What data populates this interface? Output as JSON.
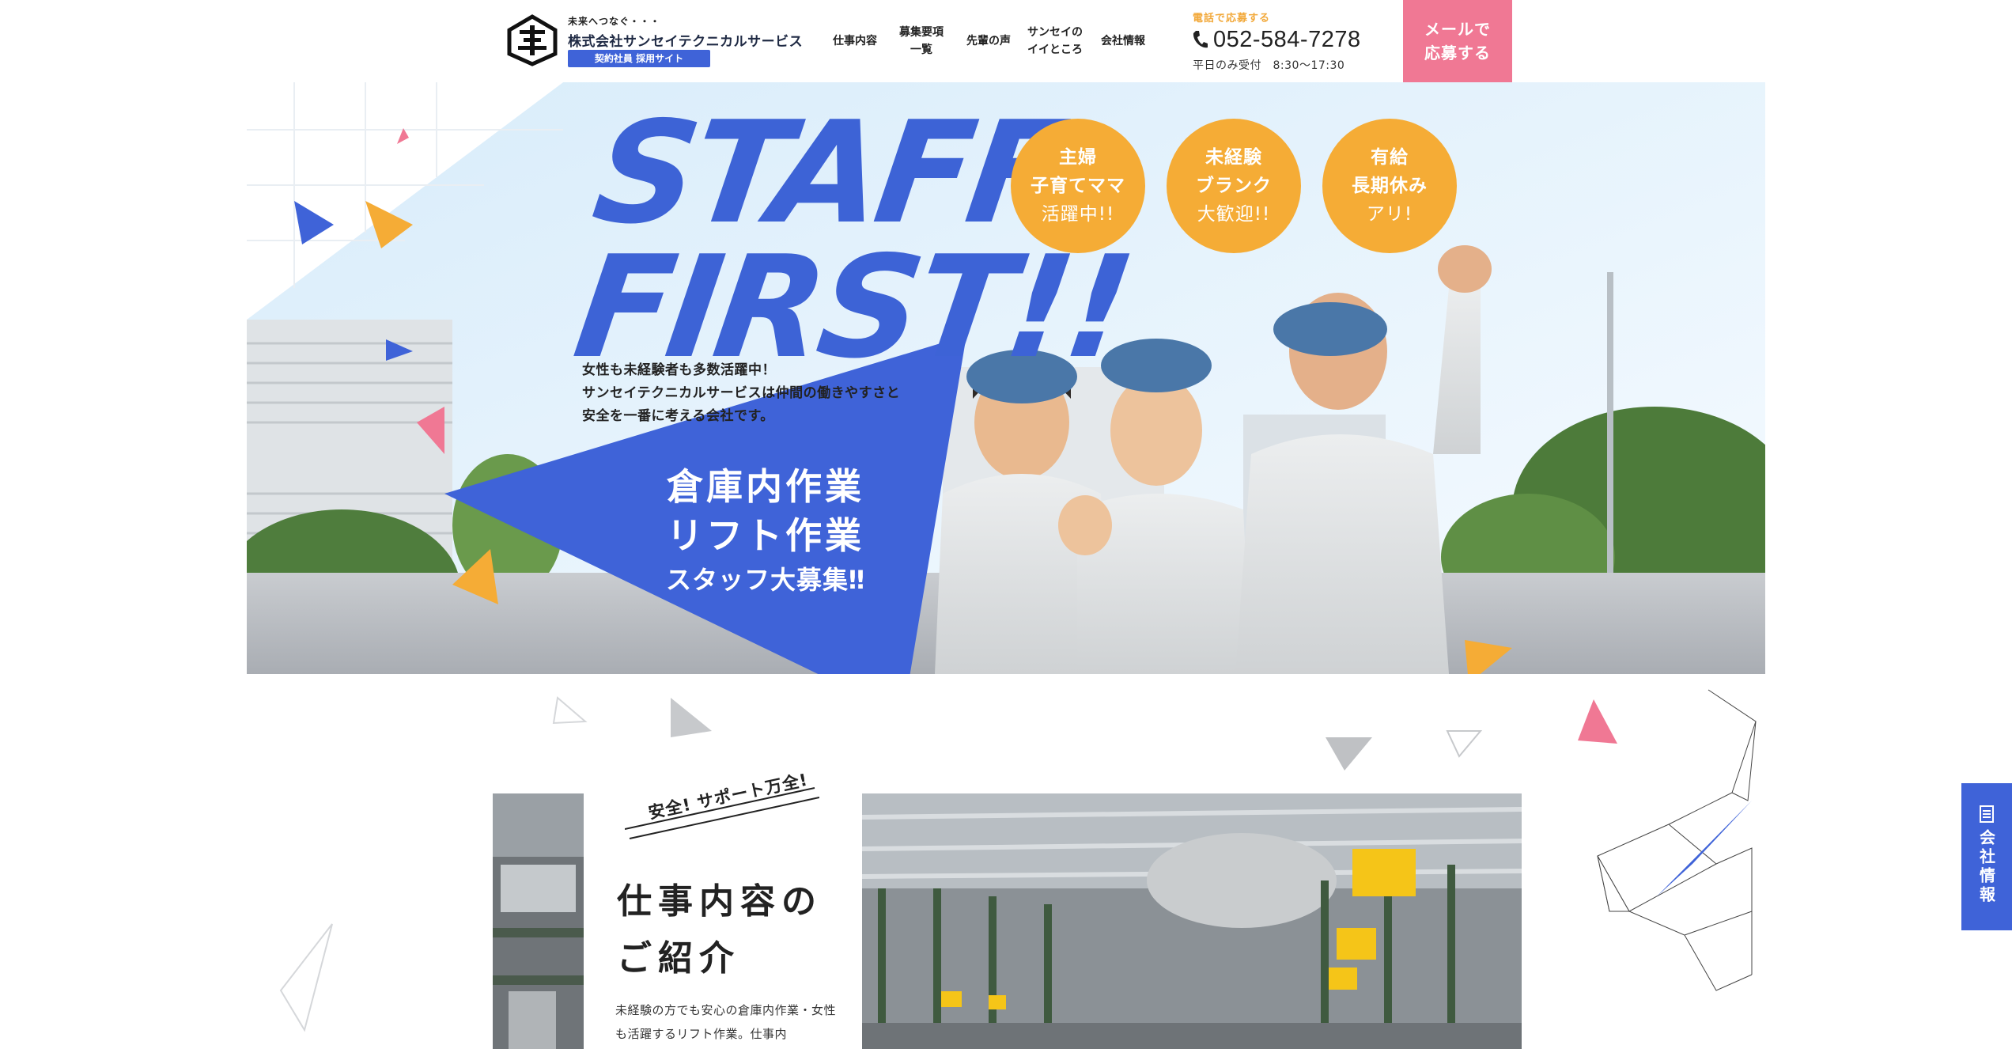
{
  "header": {
    "logo_tagline": "未来へつなぐ・・・",
    "company_name": "株式会社サンセイテクニカルサービス",
    "site_label": "契約社員 採用サイト",
    "nav": [
      {
        "lines": [
          "仕事内容"
        ]
      },
      {
        "lines": [
          "募集要項",
          "一覧"
        ]
      },
      {
        "lines": [
          "先輩の声"
        ]
      },
      {
        "lines": [
          "サンセイの",
          "イイところ"
        ]
      },
      {
        "lines": [
          "会社情報"
        ]
      }
    ],
    "tel_label": "電話で応募する",
    "tel_number": "052-584-7278",
    "tel_hours": "平日のみ受付　8:30〜17:30",
    "mail_button": [
      "メールで",
      "応募する"
    ]
  },
  "hero": {
    "title_lines": [
      "STAFF",
      "FIRST!!"
    ],
    "badges": [
      {
        "lines": [
          "主婦",
          "子育てママ",
          "活躍中!!"
        ]
      },
      {
        "lines": [
          "未経験",
          "ブランク",
          "大歓迎!!"
        ]
      },
      {
        "lines": [
          "有給",
          "長期休み",
          "アリ!"
        ]
      }
    ],
    "lead_lines": [
      "女性も未経験者も多数活躍中！",
      "サンセイテクニカルサービスは仲間の働きやすさと",
      "安全を一番に考える会社です。"
    ],
    "recruit_lines": [
      "倉庫内作業",
      "リフト作業",
      "スタッフ大募集‼"
    ]
  },
  "work_section": {
    "ribbon": "安全! サポート万全!",
    "title_lines": [
      "仕事内容の",
      "ご紹介"
    ],
    "description": "未経験の方でも安心の倉庫内作業・女性も活躍するリフト作業。仕事内"
  },
  "side_tab": {
    "label": "会社情報",
    "icon": "document-icon"
  },
  "colors": {
    "brand_blue": "#3f63d8",
    "accent_orange": "#f5ac36",
    "accent_pink": "#f07894"
  }
}
